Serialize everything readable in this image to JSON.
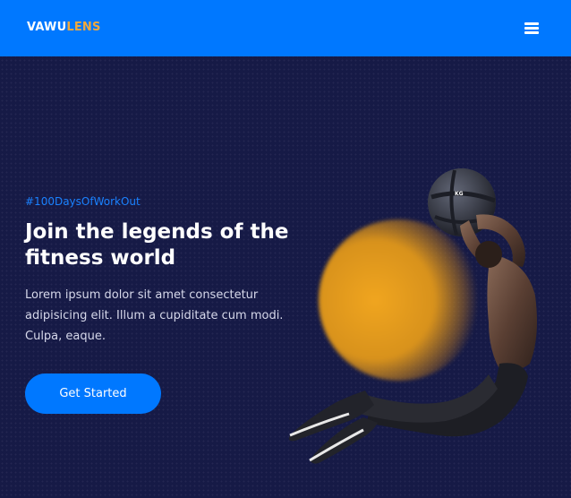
{
  "header": {
    "logo_primary": "VAWU",
    "logo_accent": "LENS",
    "menu_icon": "hamburger-menu-icon",
    "background_color": "#0078ff",
    "accent_color": "#f2a93b"
  },
  "hero": {
    "tag": "#100DaysOfWorkOut",
    "title": "Join the legends of the fitness world",
    "description": "Lorem ipsum dolor sit amet consectetur adipisicing elit. Illum a cupiditate cum modi. Culpa, eaque.",
    "cta_label": "Get Started",
    "background_color": "#161a46",
    "glow_color": "#f0a51f",
    "image": "athlete-with-medicine-ball"
  }
}
